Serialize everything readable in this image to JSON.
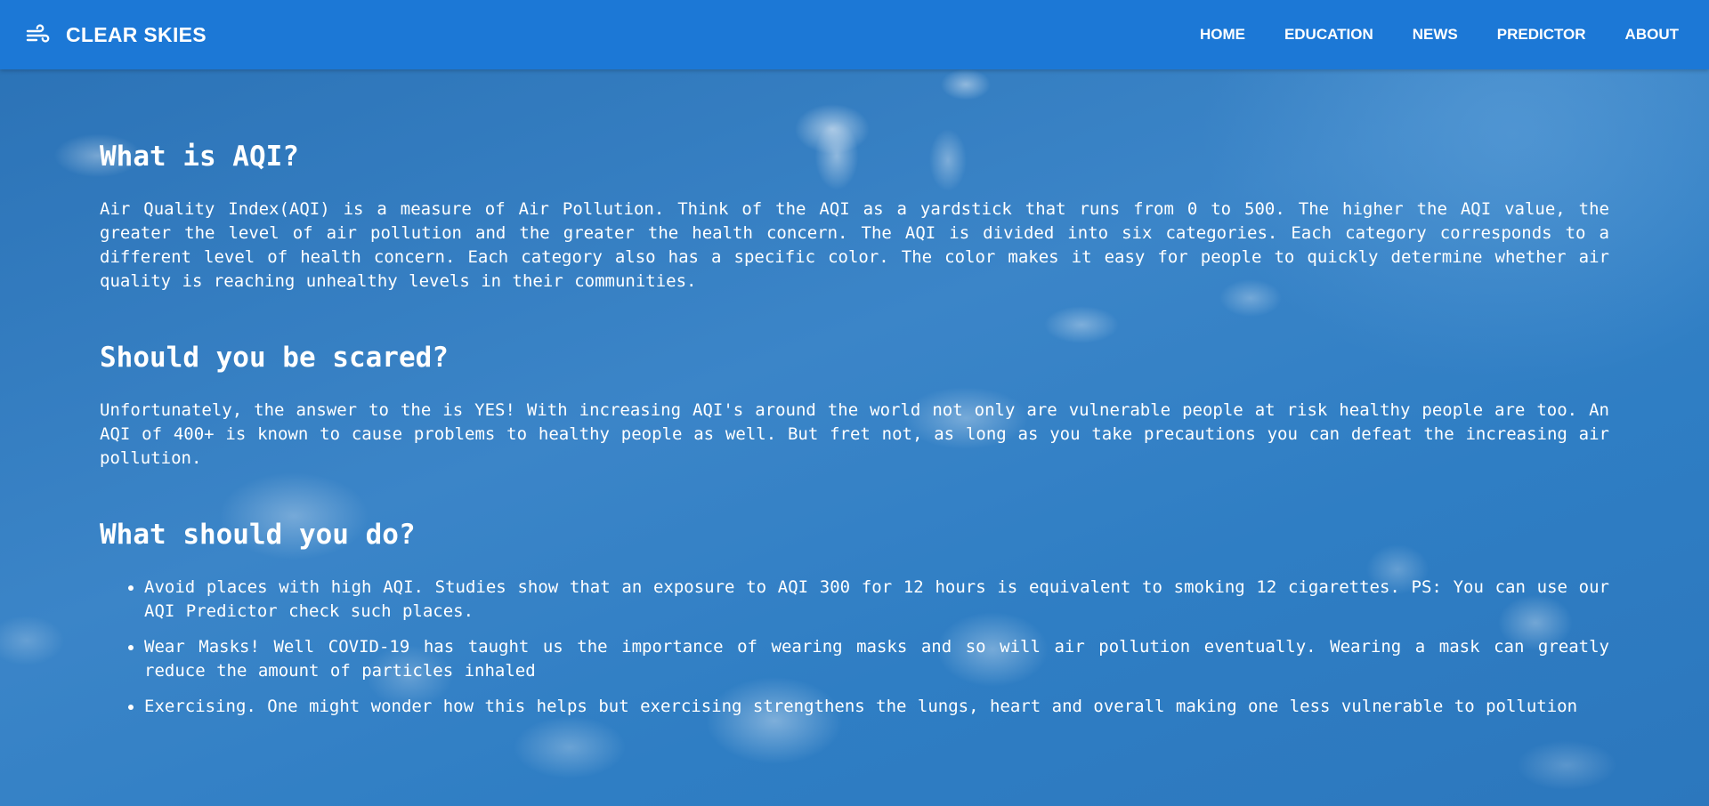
{
  "header": {
    "brand_icon": "wind-icon",
    "brand_name": "CLEAR SKIES",
    "nav": [
      {
        "label": "HOME"
      },
      {
        "label": "EDUCATION"
      },
      {
        "label": "NEWS"
      },
      {
        "label": "PREDICTOR"
      },
      {
        "label": "ABOUT"
      }
    ],
    "bar_color": "#1c78d6"
  },
  "sections": [
    {
      "heading": "What is AQI?",
      "text": "Air Quality Index(AQI) is a measure of Air Pollution. Think of the AQI as a yardstick that runs from 0 to 500. The higher the AQI value, the greater the level of air pollution and the greater the health concern. The AQI is divided into six categories. Each category corresponds to a different level of health concern. Each category also has a specific color. The color makes it easy for people to quickly determine whether air quality is reaching unhealthy levels in their communities."
    },
    {
      "heading": "Should you be scared?",
      "text": "Unfortunately, the answer to the is YES! With increasing AQI's around the world not only are vulnerable people at risk healthy people are too. An AQI of 400+ is known to cause problems to healthy people as well. But fret not, as long as you take precautions you can defeat the increasing air pollution."
    },
    {
      "heading": "What should you do?",
      "items": [
        "Avoid places with high AQI. Studies show that an exposure to AQI 300 for 12 hours is equivalent to smoking 12 cigarettes. PS: You can use our AQI Predictor check such places.",
        "Wear Masks! Well COVID-19 has taught us the importance of wearing masks and so will air pollution eventually. Wearing a mask can greatly reduce the amount of particles inhaled",
        "Exercising. One might wonder how this helps but exercising strengthens the lungs, heart and overall making one less vulnerable to pollution"
      ]
    }
  ]
}
